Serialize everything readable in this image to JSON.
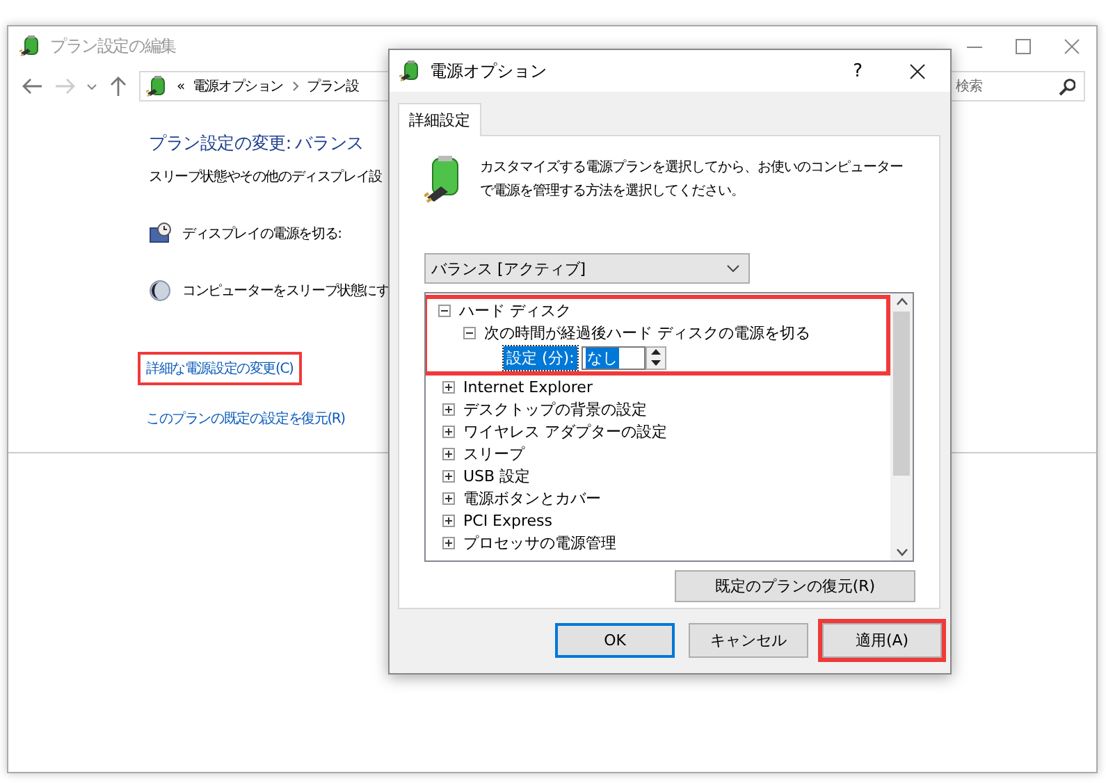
{
  "window": {
    "title": "プラン設定の編集"
  },
  "address_bar": {
    "separator": "«",
    "breadcrumbs": [
      "電源オプション",
      "プラン設"
    ]
  },
  "search": {
    "placeholder": "検索"
  },
  "plan": {
    "heading": "プラン設定の変更: バランス",
    "description": "スリープ状態やその他のディスプレイ設",
    "settings": [
      {
        "kind": "display",
        "label": "ディスプレイの電源を切る:"
      },
      {
        "kind": "sleep",
        "label": "コンピューターをスリープ状態にす"
      }
    ],
    "links": [
      {
        "label": "詳細な電源設定の変更(C)",
        "highlighted": true
      },
      {
        "label": "このプランの既定の設定を復元(R)",
        "highlighted": false
      }
    ]
  },
  "dialog": {
    "title": "電源オプション",
    "help": "?",
    "tabs": [
      {
        "label": "詳細設定",
        "selected": true
      }
    ],
    "intro": "カスタマイズする電源プランを選択してから、お使いのコンピューターで電源を管理する方法を選択してください。",
    "plan_select": {
      "value": "バランス [アクティブ]"
    },
    "tree": [
      {
        "label": "ハード ディスク",
        "expanded": true,
        "highlighted": true,
        "children": [
          {
            "label": "次の時間が経過後ハード ディスクの電源を切る",
            "expanded": true,
            "setting": {
              "label": "設定 (分):",
              "value": "なし"
            }
          }
        ]
      },
      {
        "label": "Internet Explorer",
        "expanded": false,
        "highlighted": false
      },
      {
        "label": "デスクトップの背景の設定",
        "expanded": false,
        "highlighted": false
      },
      {
        "label": "ワイヤレス アダプターの設定",
        "expanded": false,
        "highlighted": false
      },
      {
        "label": "スリープ",
        "expanded": false,
        "highlighted": false
      },
      {
        "label": "USB 設定",
        "expanded": false,
        "highlighted": false
      },
      {
        "label": "電源ボタンとカバー",
        "expanded": false,
        "highlighted": false
      },
      {
        "label": "PCI Express",
        "expanded": false,
        "highlighted": false
      },
      {
        "label": "プロセッサの電源管理",
        "expanded": false,
        "highlighted": false
      }
    ],
    "restore_button": "既定のプランの復元(R)",
    "buttons": [
      {
        "label": "OK",
        "default": true,
        "highlighted": false
      },
      {
        "label": "キャンセル",
        "default": false,
        "highlighted": false
      },
      {
        "label": "適用(A)",
        "default": false,
        "highlighted": true
      }
    ]
  }
}
